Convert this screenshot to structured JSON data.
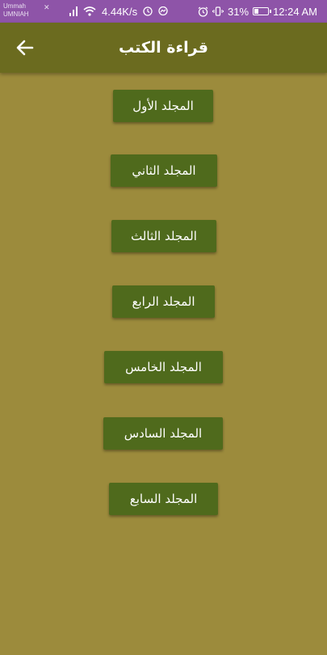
{
  "status_bar": {
    "carrier_line1": "Ummah",
    "carrier_line2": "UMNIAH",
    "net_speed": "4.44K/s",
    "battery": "31%",
    "time": "12:24 AM"
  },
  "app_bar": {
    "title": "قراءة الكتب",
    "back_icon": "arrow-left-icon"
  },
  "volumes": [
    {
      "label": "المجلد الأول"
    },
    {
      "label": "المجلد الثاني"
    },
    {
      "label": "المجلد الثالث"
    },
    {
      "label": "المجلد الرابع"
    },
    {
      "label": "المجلد الخامس"
    },
    {
      "label": "المجلد السادس"
    },
    {
      "label": "المجلد السابع"
    }
  ],
  "colors": {
    "background": "#9c8b3c",
    "app_bar": "#6b6b1f",
    "button": "#4f6a1c",
    "status_bar": "#8e54a8"
  }
}
